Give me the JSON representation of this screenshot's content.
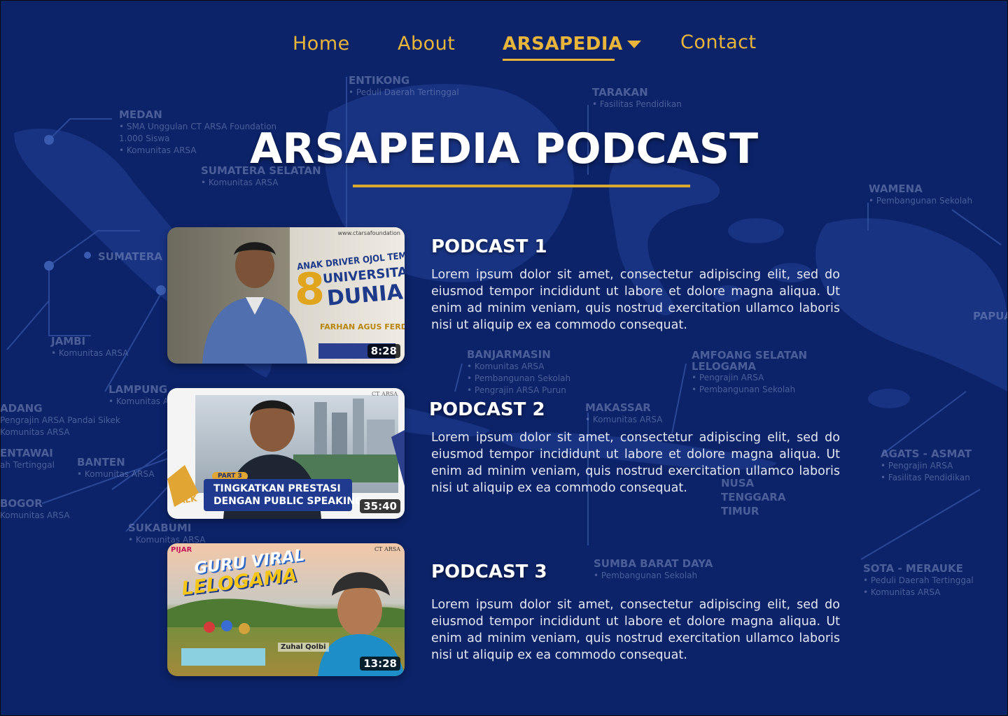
{
  "nav": {
    "home": "Home",
    "about": "About",
    "arsapedia": "ARSAPEDIA",
    "contact": "Contact"
  },
  "page_title": "ARSAPEDIA PODCAST",
  "background_map": {
    "labels": [
      {
        "name": "ENTIKONG",
        "sub": [
          "• Peduli Daerah Tertinggal"
        ]
      },
      {
        "name": "TARAKAN",
        "sub": [
          "• Fasilitas Pendidikan"
        ]
      },
      {
        "name": "MEDAN",
        "sub": [
          "• SMA Unggulan CT ARSA Foundation",
          "1.000 Siswa",
          "• Komunitas ARSA"
        ]
      },
      {
        "name": "SUMATERA SELATAN",
        "sub": [
          "• Komunitas ARSA"
        ]
      },
      {
        "name": "WAMENA",
        "sub": [
          "• Pembangunan Sekolah"
        ]
      },
      {
        "name": "SUMATERA",
        "sub": []
      },
      {
        "name": "JAMBI",
        "sub": [
          "• Komunitas ARSA"
        ]
      },
      {
        "name": "BANJARMASIN",
        "sub": [
          "• Komunitas ARSA",
          "• Pembangunan Sekolah",
          "• Pengrajin ARSA Purun"
        ]
      },
      {
        "name": "AMFOANG SELATAN LELOGAMA",
        "sub": [
          "• Pengrajin ARSA",
          "• Pembangunan Sekolah"
        ]
      },
      {
        "name": "LAMPUNG",
        "sub": [
          "• Komunitas ARSA"
        ]
      },
      {
        "name": "ADANG",
        "sub": [
          "Pengrajin ARSA Pandai Sikek",
          "Komunitas ARSA"
        ]
      },
      {
        "name": "MAKASSAR",
        "sub": [
          "• Komunitas ARSA"
        ]
      },
      {
        "name": "ENTAWAI",
        "sub": [
          "ah Tertinggal"
        ]
      },
      {
        "name": "BANTEN",
        "sub": [
          "• Komunitas ARSA"
        ]
      },
      {
        "name": "AGATS - ASMAT",
        "sub": [
          "• Pengrajin ARSA",
          "• Fasilitas Pendidikan"
        ]
      },
      {
        "name": "BOGOR",
        "sub": [
          "Komunitas ARSA"
        ]
      },
      {
        "name": "SUKABUMI",
        "sub": [
          "• Komunitas ARSA"
        ]
      },
      {
        "name": "SUMBA BARAT DAYA",
        "sub": [
          "• Pembangunan Sekolah"
        ]
      },
      {
        "name": "SOTA - MERAUKE",
        "sub": [
          "• Peduli Daerah Tertinggal",
          "• Komunitas ARSA"
        ]
      },
      {
        "name": "PAPUA",
        "sub": []
      },
      {
        "name": "NUSA TENGGARA TIMUR",
        "sub": []
      }
    ]
  },
  "podcasts": [
    {
      "title": "PODCAST 1",
      "description": "Lorem ipsum dolor sit amet, consectetur adipiscing elit, sed do eiusmod tempor incididunt ut labore et dolore magna aliqua. Ut enim ad minim veniam, quis nostrud exercitation ullamco laboris nisi ut aliquip ex ea commodo consequat.",
      "duration": "8:28",
      "thumb_text": [
        "ANAK DRIVER OJOL TEMBUS",
        "8",
        "UNIVERSITAS",
        "DUNIA",
        "FARHAN AGUS FERDIANSYAH",
        "www.ctarsafoundation"
      ]
    },
    {
      "title": "PODCAST 2",
      "description": "Lorem ipsum dolor sit amet, consectetur adipiscing elit, sed do eiusmod tempor incididunt ut labore et dolore magna aliqua. Ut enim ad minim veniam, quis nostrud exercitation ullamco laboris nisi ut aliquip ex ea commodo consequat.",
      "duration": "35:40",
      "thumb_text": [
        "PART 3",
        "TINGKATKAN PRESTASI",
        "DENGAN PUBLIC SPEAKING",
        "ARSA TALK",
        "CT ARSA"
      ]
    },
    {
      "title": "PODCAST 3",
      "description": "Lorem ipsum dolor sit amet, consectetur adipiscing elit, sed do eiusmod tempor incididunt ut labore et dolore magna aliqua. Ut enim ad minim veniam, quis nostrud exercitation ullamco laboris nisi ut aliquip ex ea commodo consequat.",
      "duration": "13:28",
      "thumb_text": [
        "GURU VIRAL",
        "LELOGAMA",
        "Zuhal Qolbi",
        "PIJAR",
        "CT ARSA"
      ]
    }
  ],
  "colors": {
    "background": "#0c2369",
    "accent": "#e8b53a",
    "title": "#ffffff"
  },
  "icons": {
    "dropdown": "caret-down-icon"
  }
}
